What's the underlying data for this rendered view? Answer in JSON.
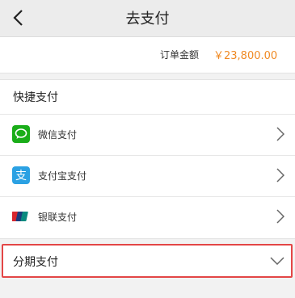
{
  "header": {
    "title": "去支付"
  },
  "order": {
    "amount_label": "订单金额",
    "amount_value": "￥23,800.00"
  },
  "quick_pay": {
    "title": "快捷支付",
    "methods": [
      {
        "label": "微信支付",
        "icon": "wechat-pay-icon"
      },
      {
        "label": "支付宝支付",
        "icon": "alipay-icon"
      },
      {
        "label": "银联支付",
        "icon": "unionpay-icon"
      }
    ]
  },
  "installment": {
    "label": "分期支付"
  },
  "colors": {
    "accent": "#f08a24",
    "highlight": "#e34646",
    "wechat": "#1aad19",
    "alipay": "#2ba1e3"
  }
}
